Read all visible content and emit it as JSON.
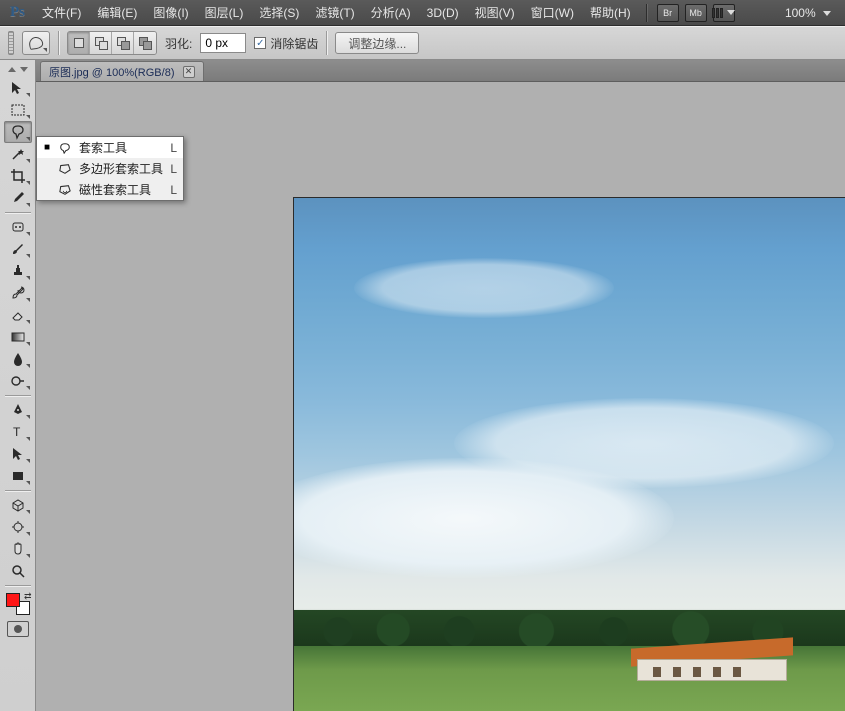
{
  "app": {
    "logo": "Ps"
  },
  "menu": {
    "items": [
      "文件(F)",
      "编辑(E)",
      "图像(I)",
      "图层(L)",
      "选择(S)",
      "滤镜(T)",
      "分析(A)",
      "3D(D)",
      "视图(V)",
      "窗口(W)",
      "帮助(H)"
    ],
    "chips": [
      "Br",
      "Mb"
    ],
    "zoom": "100%"
  },
  "options": {
    "feather_label": "羽化:",
    "feather_value": "0 px",
    "antialias_label": "消除锯齿",
    "refine_label": "调整边缘..."
  },
  "document": {
    "tab_title": "原图.jpg @ 100%(RGB/8)"
  },
  "flyout": {
    "items": [
      {
        "label": "套索工具",
        "shortcut": "L",
        "selected": true
      },
      {
        "label": "多边形套索工具",
        "shortcut": "L",
        "selected": false
      },
      {
        "label": "磁性套索工具",
        "shortcut": "L",
        "selected": false
      }
    ]
  },
  "tools": [
    {
      "id": "move",
      "name": "move-tool"
    },
    {
      "id": "marquee",
      "name": "rectangular-marquee-tool"
    },
    {
      "id": "lasso",
      "name": "lasso-tool",
      "active": true
    },
    {
      "id": "wand",
      "name": "magic-wand-tool"
    },
    {
      "id": "crop",
      "name": "crop-tool"
    },
    {
      "id": "eyedrop",
      "name": "eyedropper-tool"
    },
    {
      "id": "heal",
      "name": "healing-brush-tool"
    },
    {
      "id": "brush",
      "name": "brush-tool"
    },
    {
      "id": "stamp",
      "name": "clone-stamp-tool"
    },
    {
      "id": "history",
      "name": "history-brush-tool"
    },
    {
      "id": "eraser",
      "name": "eraser-tool"
    },
    {
      "id": "gradient",
      "name": "gradient-tool"
    },
    {
      "id": "blur",
      "name": "blur-tool"
    },
    {
      "id": "dodge",
      "name": "dodge-tool"
    },
    {
      "id": "pen",
      "name": "pen-tool"
    },
    {
      "id": "type",
      "name": "type-tool"
    },
    {
      "id": "path",
      "name": "path-selection-tool"
    },
    {
      "id": "shape",
      "name": "rectangle-shape-tool"
    },
    {
      "id": "3d",
      "name": "3d-object-tool"
    },
    {
      "id": "cam",
      "name": "3d-camera-tool"
    },
    {
      "id": "hand",
      "name": "hand-tool"
    },
    {
      "id": "zoom",
      "name": "zoom-tool"
    }
  ],
  "colors": {
    "foreground": "#ff1616",
    "background": "#ffffff",
    "accent": "#2e5b87"
  }
}
